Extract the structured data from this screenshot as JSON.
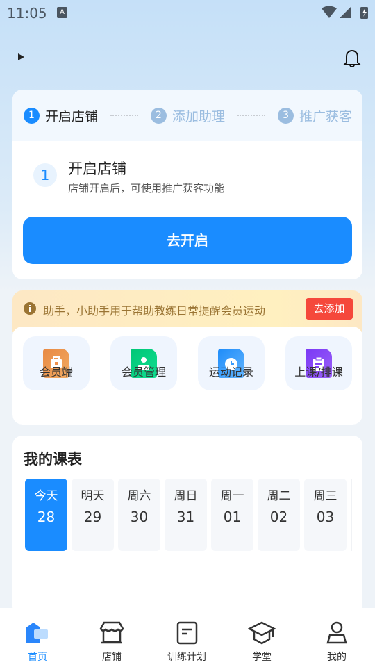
{
  "status": {
    "time": "11:05",
    "badge": "A"
  },
  "header": {
    "menu_icon": "play-triangle",
    "bell_icon": "bell"
  },
  "steps": [
    {
      "num": "1",
      "label": "开启店铺",
      "active": true
    },
    {
      "num": "2",
      "label": "添加助理",
      "active": false
    },
    {
      "num": "3",
      "label": "推广获客",
      "active": false
    }
  ],
  "step_detail": {
    "num": "1",
    "title": "开启店铺",
    "subtitle": "店铺开启后，可使用推广获客功能",
    "button": "去开启"
  },
  "banner": {
    "text": "助手，小助手用于帮助教练日常提醒会员运动",
    "button": "去添加"
  },
  "shortcuts": [
    {
      "label": "会员端",
      "icon": "briefcase",
      "color": "#ee8f4a"
    },
    {
      "label": "会员管理",
      "icon": "member-card",
      "color": "#10cf80"
    },
    {
      "label": "运动记录",
      "icon": "clock",
      "color": "#3a9cfb"
    },
    {
      "label": "上课/排课",
      "icon": "clipboard",
      "color": "#8244f5"
    }
  ],
  "schedule": {
    "title": "我的课表",
    "days": [
      {
        "label": "今天",
        "date": "28",
        "selected": true
      },
      {
        "label": "明天",
        "date": "29"
      },
      {
        "label": "周六",
        "date": "30"
      },
      {
        "label": "周日",
        "date": "31"
      },
      {
        "label": "周一",
        "date": "01"
      },
      {
        "label": "周二",
        "date": "02"
      },
      {
        "label": "周三",
        "date": "03"
      }
    ]
  },
  "nav": [
    {
      "label": "首页",
      "active": true
    },
    {
      "label": "店铺"
    },
    {
      "label": "训练计划"
    },
    {
      "label": "学堂"
    },
    {
      "label": "我的"
    }
  ],
  "colors": {
    "primary": "#1a8cff",
    "danger": "#f5483b",
    "inactive_step": "#9bbde0"
  }
}
